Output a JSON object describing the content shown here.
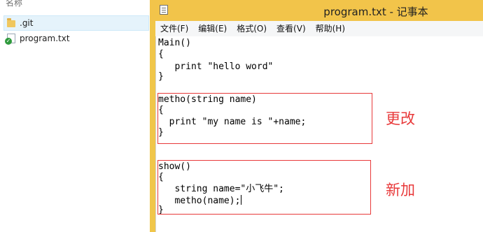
{
  "explorer": {
    "column_header": "名称",
    "files": [
      {
        "name": ".git",
        "icon": "folder-icon"
      },
      {
        "name": "program.txt",
        "icon": "text-file-icon"
      }
    ]
  },
  "notepad": {
    "title": "program.txt - 记事本",
    "menu": [
      "文件(F)",
      "编辑(E)",
      "格式(O)",
      "查看(V)",
      "帮助(H)"
    ],
    "lines": [
      "Main()",
      "{",
      "   print \"hello word\"",
      "}",
      "metho(string name)",
      "{",
      "  print \"my name is \"+name;",
      "}",
      "show()",
      "{",
      "   string name=\"小飞牛\";",
      "   metho(name);",
      "}"
    ]
  },
  "annotations": {
    "changed": "更改",
    "added": "新加",
    "color": "#e8393a"
  }
}
